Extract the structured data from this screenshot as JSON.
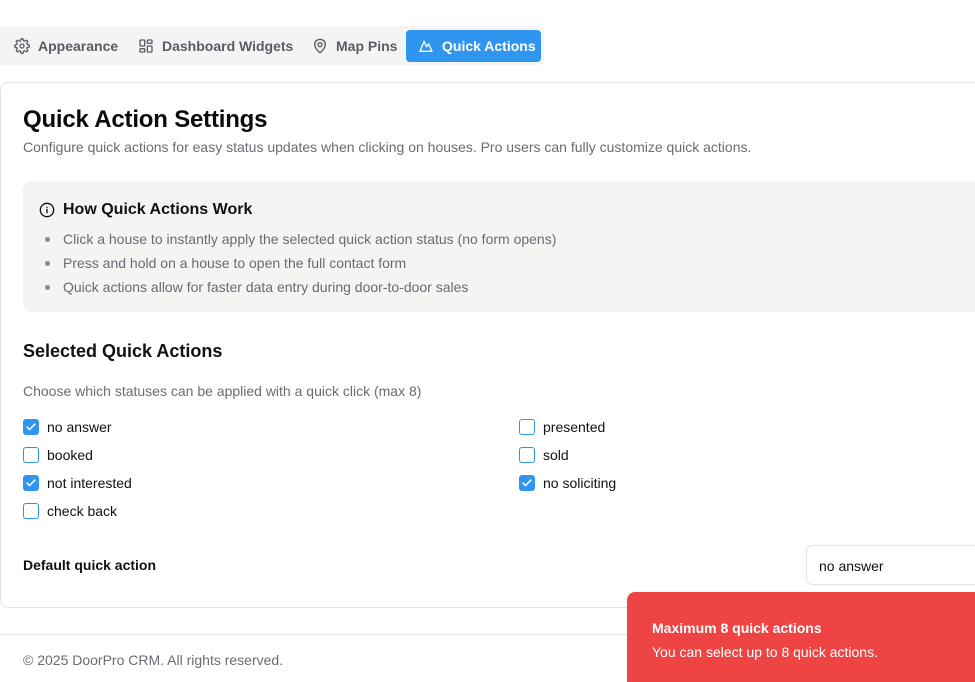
{
  "tabs": [
    {
      "label": "Appearance",
      "icon": "gear-icon"
    },
    {
      "label": "Dashboard Widgets",
      "icon": "grid-icon"
    },
    {
      "label": "Map Pins",
      "icon": "map-pin-icon"
    },
    {
      "label": "Quick Actions",
      "icon": "mountain-icon",
      "active": true
    }
  ],
  "page": {
    "title": "Quick Action Settings",
    "subtitle": "Configure quick actions for easy status updates when clicking on houses. Pro users can fully customize quick actions."
  },
  "info": {
    "title": "How Quick Actions Work",
    "icon": "info-icon",
    "bullets": [
      "Click a house to instantly apply the selected quick action status (no form opens)",
      "Press and hold on a house to open the full contact form",
      "Quick actions allow for faster data entry during door-to-door sales"
    ]
  },
  "selected": {
    "title": "Selected Quick Actions",
    "subtitle": "Choose which statuses can be applied with a quick click (max 8)",
    "options": [
      {
        "label": "no answer",
        "checked": true
      },
      {
        "label": "presented",
        "checked": false
      },
      {
        "label": "booked",
        "checked": false
      },
      {
        "label": "sold",
        "checked": false
      },
      {
        "label": "not interested",
        "checked": true
      },
      {
        "label": "no soliciting",
        "checked": true
      },
      {
        "label": "check back",
        "checked": false
      }
    ]
  },
  "default_action": {
    "label": "Default quick action",
    "value": "no answer"
  },
  "footer": {
    "text": "© 2025 DoorPro CRM. All rights reserved."
  },
  "toast": {
    "title": "Maximum 8 quick actions",
    "message": "You can select up to 8 quick actions."
  },
  "colors": {
    "accent": "#2f95ee",
    "toast_bg": "#ef4444"
  }
}
